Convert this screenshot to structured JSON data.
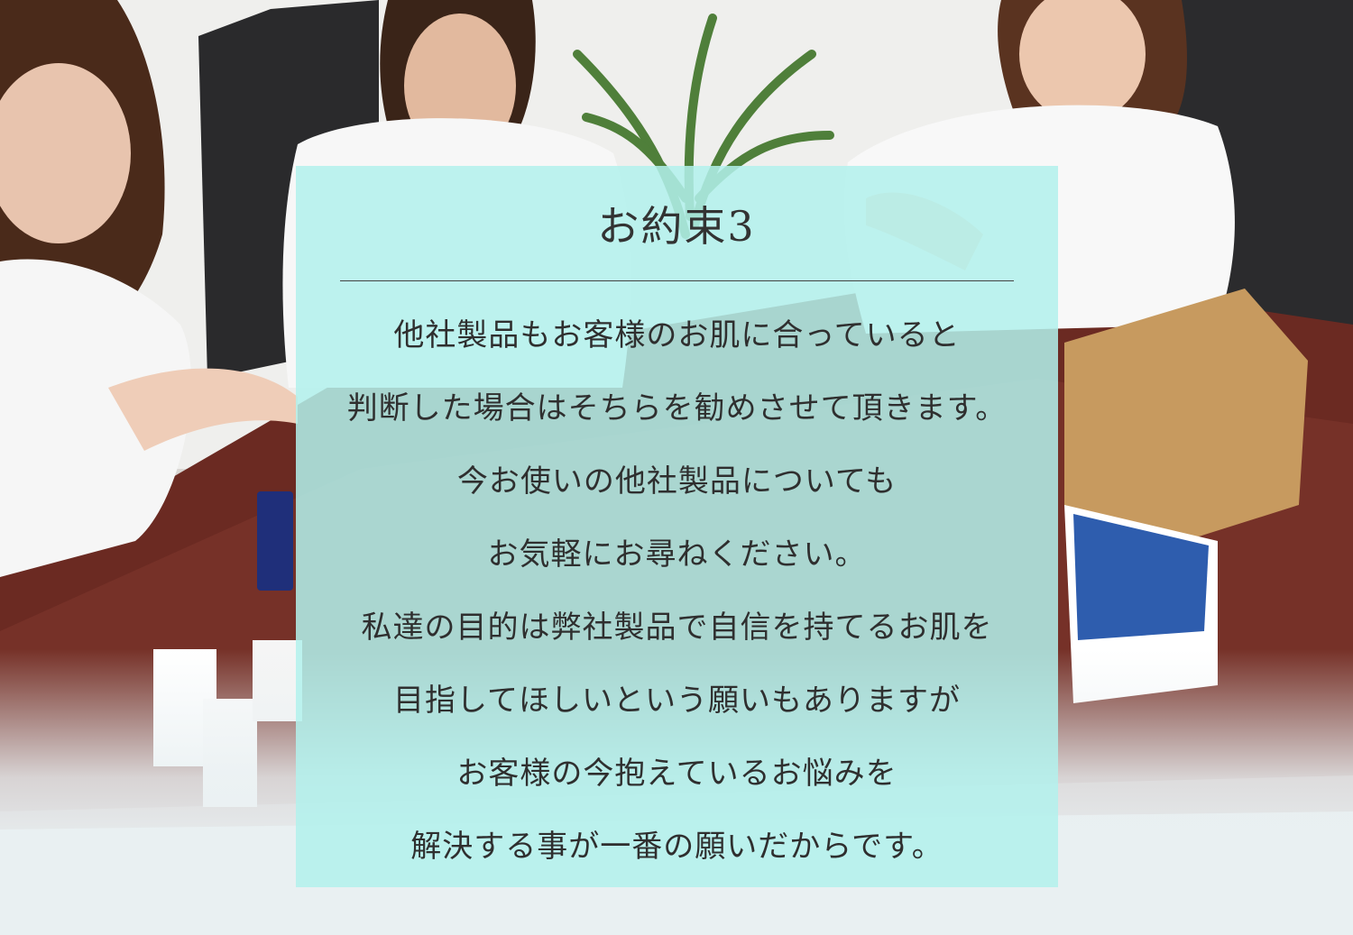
{
  "promise": {
    "title": "お約束3",
    "lines": [
      "他社製品もお客様のお肌に合っていると",
      "判断した場合はそちらを勧めさせて頂きます。",
      "今お使いの他社製品についても",
      "お気軽にお尋ねください。",
      "私達の目的は弊社製品で自信を持てるお肌を",
      "目指してほしいという願いもありますが",
      "お客様の今抱えているお悩みを",
      "解決する事が一番の願いだからです。"
    ]
  },
  "colors": {
    "card_background": "#b2f1ec",
    "text": "#2f2f2f",
    "page_background": "#e9f0f2"
  }
}
